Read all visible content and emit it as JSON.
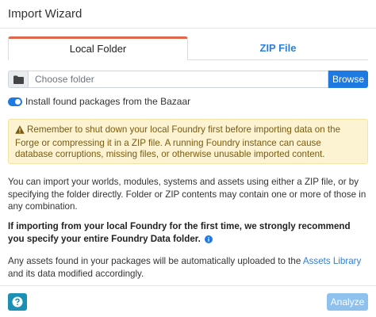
{
  "window": {
    "title": "Import Wizard"
  },
  "tabs": [
    {
      "label": "Local Folder",
      "active": true
    },
    {
      "label": "ZIP File",
      "active": false
    }
  ],
  "folder": {
    "placeholder": "Choose folder",
    "value": "",
    "browse_label": "Browse",
    "icon": "folder-icon"
  },
  "bazaar_toggle": {
    "label": "Install found packages from the Bazaar",
    "checked": true
  },
  "warning": {
    "icon": "warning-triangle-icon",
    "text": "Remember to shut down your local Foundry first before importing data on the Forge or compressing it in a ZIP file. A running Foundry instance can cause database corruptions, missing files, or otherwise unusable imported content."
  },
  "info": {
    "paragraph1": "You can import your worlds, modules, systems and assets using either a ZIP file, or by specifying the folder directly. Folder or ZIP contents may contain one or more of those in any combination.",
    "paragraph2": "If importing from your local Foundry for the first time, we strongly recommend you specify your entire Foundry Data folder.",
    "paragraph3_before": "Any assets found in your packages will be automatically uploaded to the ",
    "paragraph3_link": "Assets Library",
    "paragraph3_after": " and its data modified accordingly."
  },
  "footer": {
    "help_icon": "question-icon",
    "analyze_label": "Analyze",
    "analyze_enabled": false
  },
  "colors": {
    "accent": "#1e7ae0",
    "tab_active_border": "#e0674b",
    "warning_bg": "#fcf3d2",
    "link": "#2f7fd6",
    "help_btn": "#1b8fb4",
    "analyze_disabled": "#8fc1ee"
  }
}
